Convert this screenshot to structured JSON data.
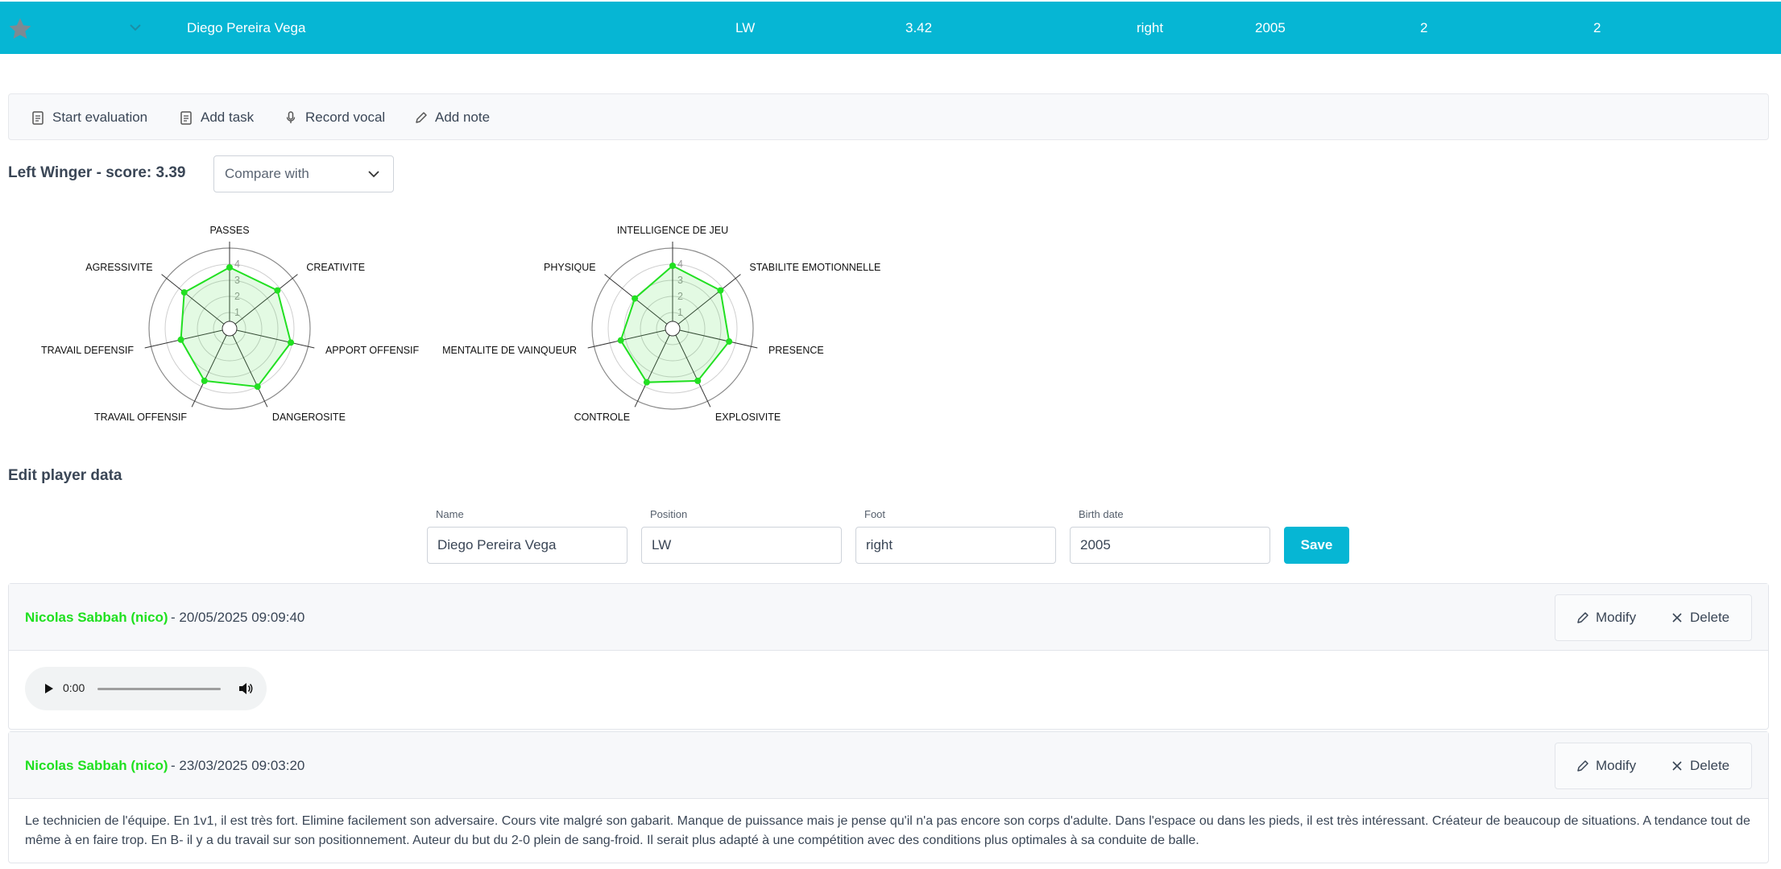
{
  "player_row": {
    "name": "Diego Pereira Vega",
    "position": "LW",
    "score": "3.42",
    "foot": "right",
    "birth_year": "2005",
    "col_a": "2",
    "col_b": "2"
  },
  "toolbar": {
    "start_evaluation": "Start evaluation",
    "add_task": "Add task",
    "record_vocal": "Record vocal",
    "add_note": "Add note"
  },
  "evaluation": {
    "title": "Left Winger - score: 3.39",
    "compare_placeholder": "Compare with"
  },
  "chart_data": [
    {
      "type": "radar",
      "scale_max": 5,
      "tick_labels": [
        "1",
        "2",
        "3",
        "4"
      ],
      "categories": [
        "PASSES",
        "CREATIVITE",
        "APPORT OFFENSIF",
        "DANGEROSITE",
        "TRAVAIL OFFENSIF",
        "TRAVAIL DEFENSIF",
        "AGRESSIVITE"
      ],
      "values": [
        3.8,
        3.8,
        3.9,
        4.0,
        3.6,
        3.1,
        3.6
      ],
      "color": "#22e022"
    },
    {
      "type": "radar",
      "scale_max": 5,
      "tick_labels": [
        "1",
        "2",
        "3",
        "4"
      ],
      "categories": [
        "INTELLIGENCE DE JEU",
        "STABILITE EMOTIONNELLE",
        "PRESENCE",
        "EXPLOSIVITE",
        "CONTROLE",
        "MENTALITE DE VAINQUEUR",
        "PHYSIQUE"
      ],
      "values": [
        3.9,
        3.8,
        3.6,
        3.6,
        3.7,
        3.3,
        3.0
      ],
      "color": "#22e022"
    }
  ],
  "edit": {
    "title": "Edit player data",
    "name_label": "Name",
    "name_value": "Diego Pereira Vega",
    "position_label": "Position",
    "position_value": "LW",
    "foot_label": "Foot",
    "foot_value": "right",
    "birth_label": "Birth date",
    "birth_value": "2005",
    "save_label": "Save"
  },
  "notes": [
    {
      "author": "Nicolas Sabbah (nico)",
      "date": "- 20/05/2025 09:09:40",
      "modify": "Modify",
      "delete": "Delete",
      "audio_time": "0:00"
    },
    {
      "author": "Nicolas Sabbah (nico)",
      "date": "- 23/03/2025 09:03:20",
      "modify": "Modify",
      "delete": "Delete",
      "text": "Le technicien de l'équipe. En 1v1, il est très fort. Elimine facilement son adversaire. Cours vite malgré son gabarit. Manque de puissance mais je pense qu'il n'a pas encore son corps d'adulte. Dans l'espace ou dans les pieds, il est très intéressant. Créateur de beaucoup de situations. A tendance tout de même à en faire trop. En B- il y a du travail sur son positionnement. Auteur du but du 2-0 plein de sang-froid. Il serait plus adapté à une compétition avec des conditions plus optimales à sa conduite de balle."
    }
  ],
  "colors": {
    "accent": "#06b6d4",
    "author": "#1fe01f"
  }
}
